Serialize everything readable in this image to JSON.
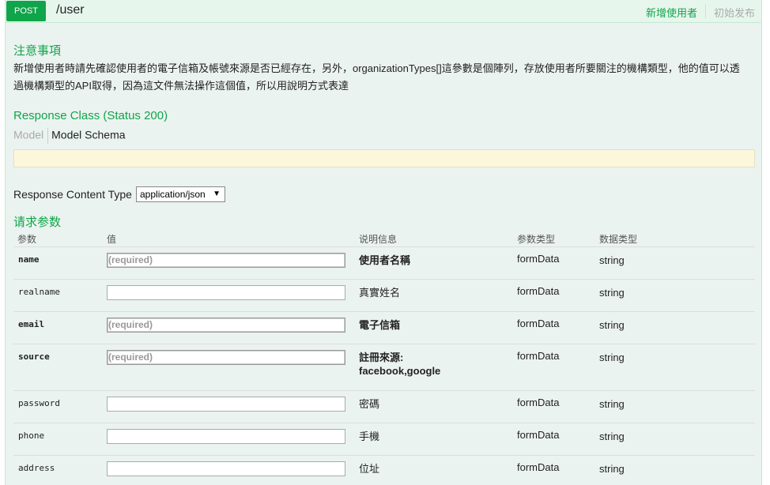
{
  "operation": {
    "method": "POST",
    "path": "/user",
    "summary": "新增使用者",
    "tag": "初始发布"
  },
  "notes": {
    "heading": "注意事項",
    "text": "新增使用者時請先確認使用者的電子信箱及帳號來源是否已經存在，另外，organizationTypes[]這參數是個陣列，存放使用者所要關注的機構類型，他的值可以透過機構類型的API取得，因為這文件無法操作這個值，所以用說明方式表達"
  },
  "response_class": {
    "heading": "Response Class (Status 200)",
    "tab_model": "Model",
    "tab_schema": "Model Schema"
  },
  "response_content_type": {
    "label": "Response Content Type",
    "selected": "application/json"
  },
  "parameters": {
    "heading": "请求参数",
    "columns": {
      "param": "参数",
      "value": "值",
      "description": "说明信息",
      "param_type": "参数类型",
      "data_type": "数据类型"
    },
    "rows": [
      {
        "name": "name",
        "placeholder": "(required)",
        "description": "使用者名稱",
        "param_type": "formData",
        "data_type": "string"
      },
      {
        "name": "realname",
        "placeholder": "",
        "description": "真實姓名",
        "param_type": "formData",
        "data_type": "string"
      },
      {
        "name": "email",
        "placeholder": "(required)",
        "description": "電子信箱",
        "param_type": "formData",
        "data_type": "string"
      },
      {
        "name": "source",
        "placeholder": "(required)",
        "description": "註冊來源: facebook,google",
        "param_type": "formData",
        "data_type": "string"
      },
      {
        "name": "password",
        "placeholder": "",
        "description": "密碼",
        "param_type": "formData",
        "data_type": "string"
      },
      {
        "name": "phone",
        "placeholder": "",
        "description": "手機",
        "param_type": "formData",
        "data_type": "string"
      },
      {
        "name": "address",
        "placeholder": "",
        "description": "位址",
        "param_type": "formData",
        "data_type": "string"
      }
    ]
  }
}
